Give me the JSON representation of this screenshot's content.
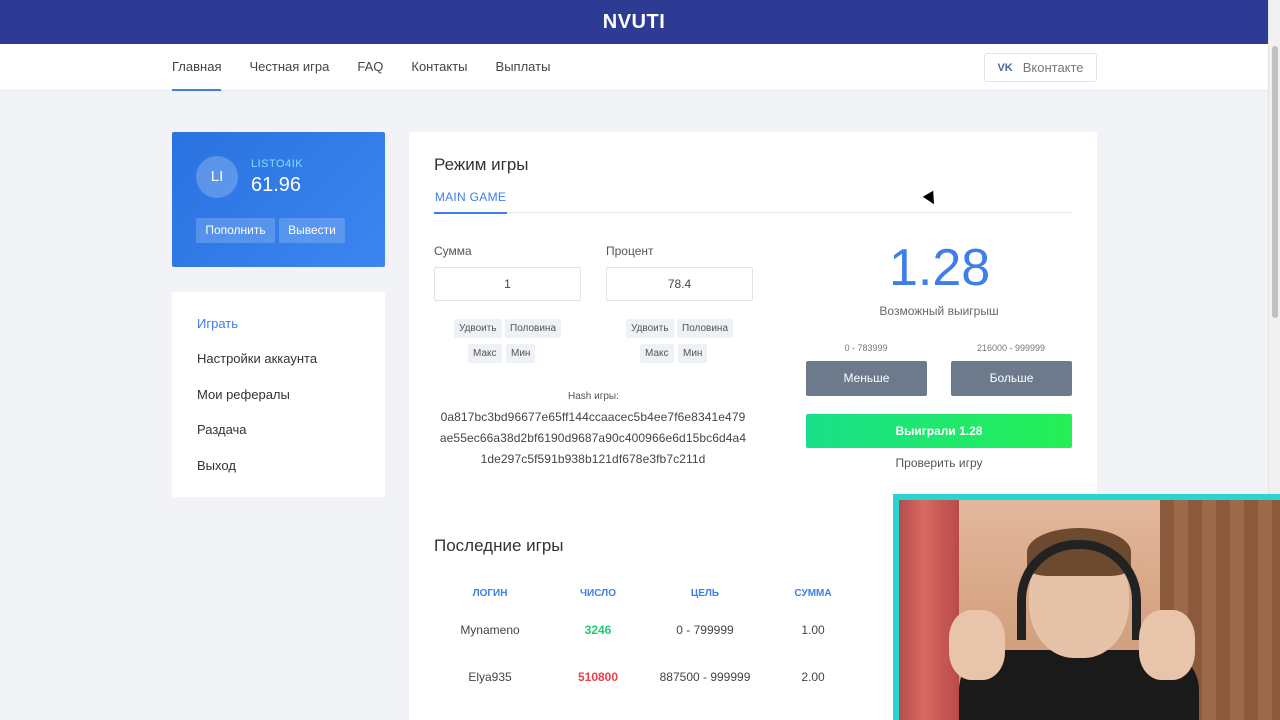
{
  "header": {
    "brand": "NVUTI"
  },
  "nav": {
    "links": [
      "Главная",
      "Честная игра",
      "FAQ",
      "Контакты",
      "Выплаты"
    ],
    "vk_label": "Вконтакте"
  },
  "user": {
    "initials": "LI",
    "name": "LISTO4IK",
    "balance": "61.96",
    "deposit_label": "Пополнить",
    "withdraw_label": "Вывести"
  },
  "menu": {
    "items": [
      "Играть",
      "Настройки аккаунта",
      "Мои рефералы",
      "Раздача",
      "Выход"
    ]
  },
  "game": {
    "title": "Режим игры",
    "tab": "MAIN GAME",
    "amount_label": "Сумма",
    "amount_value": "1",
    "percent_label": "Процент",
    "percent_value": "78.4",
    "chips": {
      "double": "Удвоить",
      "half": "Половина",
      "max": "Макс",
      "min": "Мин"
    },
    "hash_label": "Hash игры:",
    "hash_lines": [
      "0a817bc3bd96677e65ff144ccaacec5b4ee7f6e8341e479",
      "ae55ec66a38d2bf6190d9687a90c400966e6d15bc6d4a4",
      "1de297c5f591b938b121df678e3fb7c211d"
    ],
    "possible_win": "1.28",
    "possible_win_label": "Возможный выигрыш",
    "less_range": "0 - 783999",
    "more_range": "216000 - 999999",
    "less_label": "Меньше",
    "more_label": "Больше",
    "result_label": "Выиграли 1.28",
    "check_label": "Проверить игру"
  },
  "recent": {
    "title": "Последние игры",
    "headers": [
      "ЛОГИН",
      "ЧИСЛО",
      "ЦЕЛЬ",
      "СУММА"
    ],
    "rows": [
      {
        "login": "Mynameno",
        "number": "3246",
        "target": "0 - 799999",
        "amount": "1.00",
        "result": "win"
      },
      {
        "login": "Elya935",
        "number": "510800",
        "target": "887500 - 999999",
        "amount": "2.00",
        "result": "lose"
      }
    ]
  },
  "colors": {
    "topbar": "#2d3b94",
    "accent": "#3d7ee8",
    "win": "#1fcc74",
    "lose": "#e8414a"
  }
}
